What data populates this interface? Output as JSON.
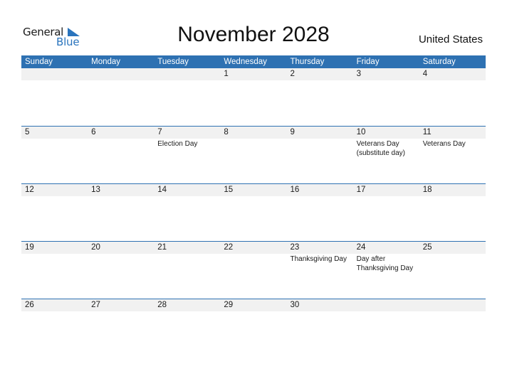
{
  "logo": {
    "line1": "General",
    "line2": "Blue"
  },
  "title": "November 2028",
  "country": "United States",
  "colors": {
    "accent": "#2e71b2",
    "band": "#f1f1f1",
    "logo_blue": "#2a74bd"
  },
  "weekdays": [
    "Sunday",
    "Monday",
    "Tuesday",
    "Wednesday",
    "Thursday",
    "Friday",
    "Saturday"
  ],
  "weeks": [
    [
      {
        "day": "",
        "events": ""
      },
      {
        "day": "",
        "events": ""
      },
      {
        "day": "",
        "events": ""
      },
      {
        "day": "1",
        "events": ""
      },
      {
        "day": "2",
        "events": ""
      },
      {
        "day": "3",
        "events": ""
      },
      {
        "day": "4",
        "events": ""
      }
    ],
    [
      {
        "day": "5",
        "events": ""
      },
      {
        "day": "6",
        "events": ""
      },
      {
        "day": "7",
        "events": "Election Day"
      },
      {
        "day": "8",
        "events": ""
      },
      {
        "day": "9",
        "events": ""
      },
      {
        "day": "10",
        "events": "Veterans Day (substitute day)"
      },
      {
        "day": "11",
        "events": "Veterans Day"
      }
    ],
    [
      {
        "day": "12",
        "events": ""
      },
      {
        "day": "13",
        "events": ""
      },
      {
        "day": "14",
        "events": ""
      },
      {
        "day": "15",
        "events": ""
      },
      {
        "day": "16",
        "events": ""
      },
      {
        "day": "17",
        "events": ""
      },
      {
        "day": "18",
        "events": ""
      }
    ],
    [
      {
        "day": "19",
        "events": ""
      },
      {
        "day": "20",
        "events": ""
      },
      {
        "day": "21",
        "events": ""
      },
      {
        "day": "22",
        "events": ""
      },
      {
        "day": "23",
        "events": "Thanksgiving Day"
      },
      {
        "day": "24",
        "events": "Day after Thanksgiving Day"
      },
      {
        "day": "25",
        "events": ""
      }
    ],
    [
      {
        "day": "26",
        "events": ""
      },
      {
        "day": "27",
        "events": ""
      },
      {
        "day": "28",
        "events": ""
      },
      {
        "day": "29",
        "events": ""
      },
      {
        "day": "30",
        "events": ""
      },
      {
        "day": "",
        "events": ""
      },
      {
        "day": "",
        "events": ""
      }
    ]
  ]
}
